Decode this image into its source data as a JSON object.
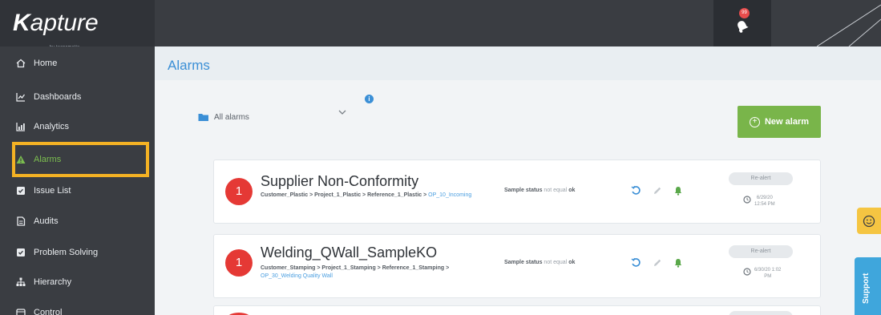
{
  "brand": {
    "logo_k": "K",
    "logo_rest": "apture",
    "logo_sub": "by tecnomatix"
  },
  "notifications": {
    "badge": "99"
  },
  "sidebar": {
    "items": [
      {
        "label": "Home",
        "icon": "home-icon"
      },
      {
        "label": "Dashboards",
        "icon": "line-chart-icon"
      },
      {
        "label": "Analytics",
        "icon": "bar-chart-icon"
      },
      {
        "label": "Alarms",
        "icon": "warning-icon",
        "active": true
      },
      {
        "label": "Issue List",
        "icon": "checkbox-icon"
      },
      {
        "label": "Audits",
        "icon": "document-icon"
      },
      {
        "label": "Problem Solving",
        "icon": "checkbox-icon"
      },
      {
        "label": "Hierarchy",
        "icon": "hierarchy-icon"
      },
      {
        "label": "Control",
        "icon": "control-icon"
      }
    ]
  },
  "page": {
    "title": "Alarms"
  },
  "filter": {
    "selected": "All alarms",
    "info": "i"
  },
  "new_alarm": {
    "label": "New alarm"
  },
  "alarms": [
    {
      "count": "1",
      "name": "Supplier Non-Conformity",
      "path_bold": "Customer_Plastic > Project_1_Plastic > Reference_1_Plastic >",
      "path_link": "OP_10_Incoming",
      "status_label": "Sample status",
      "status_op": "not equal",
      "status_value": "ok",
      "realert": "Re-alert",
      "date_line1": "6/29/20",
      "date_line2": "12:54 PM"
    },
    {
      "count": "1",
      "name": "Welding_QWall_SampleKO",
      "path_bold": "Customer_Stamping > Project_1_Stamping > Reference_1_Stamping >",
      "path_link": "OP_30_Welding Quality Wall",
      "status_label": "Sample status",
      "status_op": "not equal",
      "status_value": "ok",
      "realert": "Re-alert",
      "date_line1": "6/30/20 1:02",
      "date_line2": "PM"
    }
  ],
  "support": {
    "label": "Support"
  },
  "colors": {
    "accent_green": "#79b54a",
    "highlight": "#f4b224",
    "title_blue": "#3b8fd6",
    "alarm_red": "#e53935"
  }
}
